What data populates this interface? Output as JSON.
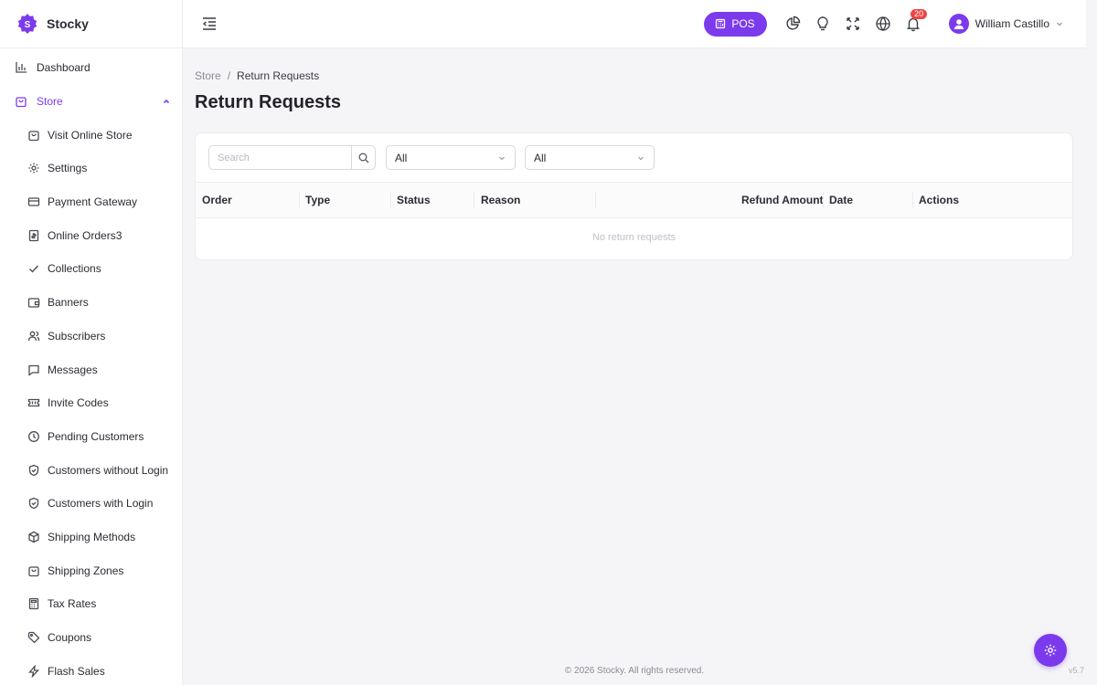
{
  "brand": {
    "name": "Stocky",
    "logo_letter": "S",
    "accent": "#7c3aed"
  },
  "sidebar": {
    "items": [
      {
        "label": "Dashboard",
        "icon": "bar-chart-icon"
      },
      {
        "label": "Store",
        "icon": "shopping-bag-icon",
        "expanded": true
      },
      {
        "label": "Visit Online Store",
        "icon": "shopping-bag-icon"
      },
      {
        "label": "Settings",
        "icon": "gear-icon"
      },
      {
        "label": "Payment Gateway",
        "icon": "credit-card-icon"
      },
      {
        "label": "Online Orders3",
        "icon": "receipt-icon"
      },
      {
        "label": "Collections",
        "icon": "check-icon"
      },
      {
        "label": "Banners",
        "icon": "wallet-icon"
      },
      {
        "label": "Subscribers",
        "icon": "users-icon"
      },
      {
        "label": "Messages",
        "icon": "message-icon"
      },
      {
        "label": "Invite Codes",
        "icon": "ticket-icon"
      },
      {
        "label": "Pending Customers",
        "icon": "clock-icon"
      },
      {
        "label": "Customers without Login",
        "icon": "shield-icon"
      },
      {
        "label": "Customers with Login",
        "icon": "shield-check-icon"
      },
      {
        "label": "Shipping Methods",
        "icon": "box-icon"
      },
      {
        "label": "Shipping Zones",
        "icon": "shopping-bag-icon"
      },
      {
        "label": "Tax Rates",
        "icon": "calculator-icon"
      },
      {
        "label": "Coupons",
        "icon": "tag-icon"
      },
      {
        "label": "Flash Sales",
        "icon": "lightning-icon"
      }
    ]
  },
  "topbar": {
    "pos_label": "POS",
    "notification_count": "20",
    "user_name": "William Castillo"
  },
  "breadcrumb": {
    "parent": "Store",
    "separator": "/",
    "current": "Return Requests"
  },
  "page": {
    "title": "Return Requests"
  },
  "filters": {
    "search_placeholder": "Search",
    "type_select": "All",
    "status_select": "All"
  },
  "table": {
    "columns": [
      "Order",
      "Type",
      "Status",
      "Reason",
      "Refund Amount",
      "Date",
      "Actions"
    ],
    "empty_message": "No return requests"
  },
  "footer": {
    "copyright": "© 2026 Stocky. All rights reserved.",
    "version": "v5.7"
  }
}
